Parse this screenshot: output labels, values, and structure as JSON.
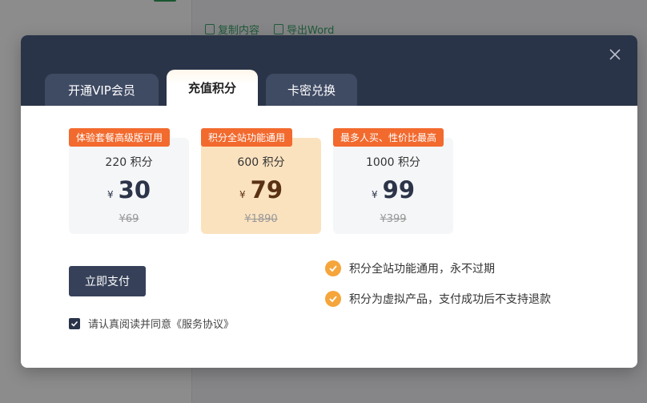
{
  "background": {
    "toolbar": {
      "copy_label": "复制内容",
      "export_label": "导出Word"
    }
  },
  "modal": {
    "tabs": [
      {
        "label": "开通VIP会员"
      },
      {
        "label": "充值积分"
      },
      {
        "label": "卡密兑换"
      }
    ],
    "active_tab": "充值积分",
    "plans": [
      {
        "badge": "体验套餐高级版可用",
        "points": "220 积分",
        "currency": "¥",
        "price": "30",
        "original": "¥69",
        "selected": false
      },
      {
        "badge": "积分全站功能通用",
        "points": "600 积分",
        "currency": "¥",
        "price": "79",
        "original": "¥1890",
        "selected": true
      },
      {
        "badge": "最多人买、性价比最高",
        "points": "1000 积分",
        "currency": "¥",
        "price": "99",
        "original": "¥399",
        "selected": false
      }
    ],
    "pay_button": "立即支付",
    "agreement": {
      "checked": true,
      "text": "请认真阅读并同意《服务协议》"
    },
    "features": [
      {
        "text": "积分全站功能通用，永不过期"
      },
      {
        "text": "积分为虚拟产品，支付成功后不支持退款"
      }
    ]
  },
  "colors": {
    "header_bg": "#2a3448",
    "badge": "#f26a2e",
    "selected_plan": "#fbe2bf",
    "check_accent": "#f5a53b",
    "pay_button": "#364159"
  }
}
